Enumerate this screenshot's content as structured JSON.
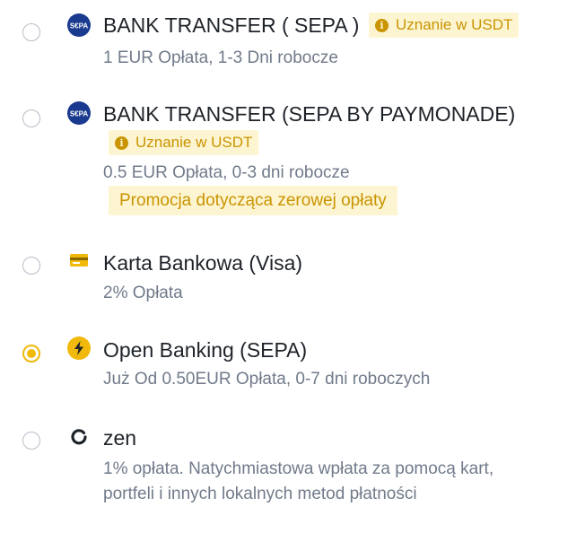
{
  "options": [
    {
      "title": "BANK TRANSFER ( SEPA )",
      "badge": "Uznanie w USDT",
      "detail": "1 EUR Opłata, 1-3 Dni robocze",
      "logo": "sepa-logo",
      "selected": false
    },
    {
      "title": "BANK TRANSFER (SEPA BY PAYMONADE)",
      "badge": "Uznanie w USDT",
      "detail": "0.5 EUR Opłata, 0-3 dni robocze",
      "promo": "Promocja dotycząca zerowej opłaty",
      "logo": "sepa-logo",
      "selected": false
    },
    {
      "title": "Karta Bankowa (Visa)",
      "detail": "2% Opłata",
      "logo": "card-icon",
      "selected": false
    },
    {
      "title": "Open Banking (SEPA)",
      "detail": "Już Od 0.50EUR Opłata, 0-7 dni roboczych",
      "logo": "lightning-icon",
      "selected": true
    },
    {
      "title": "zen",
      "detail_line1": "1% opłata. Natychmiastowa wpłata za pomocą kart,",
      "detail_line2": "portfeli i innych lokalnych metod płatności",
      "logo": "zen-logo",
      "selected": false
    }
  ],
  "sepa_logo_text": "SEPA",
  "colors": {
    "accent": "#f0b90b",
    "badge_bg": "#fdf5d1",
    "badge_text": "#c99400",
    "title": "#1e2329",
    "subtext": "#707a8a"
  }
}
